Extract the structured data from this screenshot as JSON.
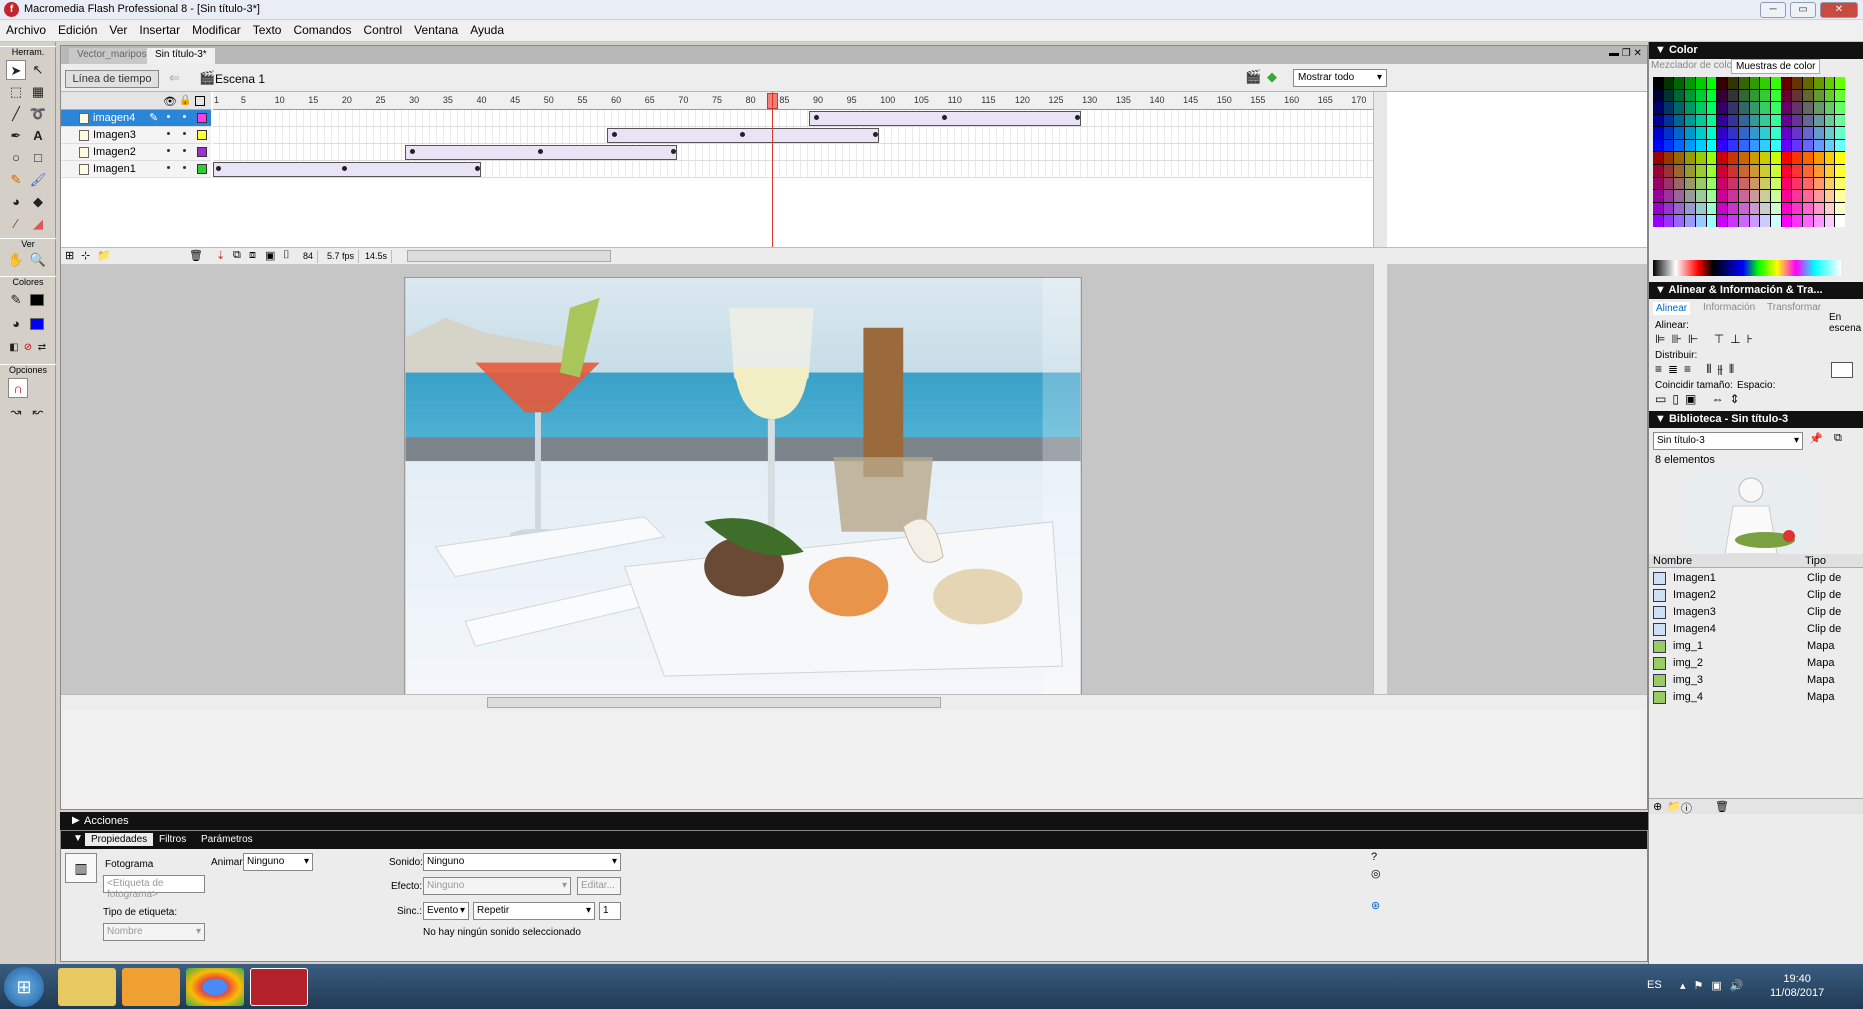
{
  "window": {
    "title": "Macromedia Flash Professional 8 - [Sin título-3*]"
  },
  "menu": [
    "Archivo",
    "Edición",
    "Ver",
    "Insertar",
    "Modificar",
    "Texto",
    "Comandos",
    "Control",
    "Ventana",
    "Ayuda"
  ],
  "tools": {
    "heading": "Herram.",
    "view_heading": "Ver",
    "colors_heading": "Colores",
    "options_heading": "Opciones"
  },
  "doc": {
    "tabs": [
      "Vector_mariposa",
      "Sin título-3*"
    ],
    "timeline_button": "Línea de tiempo",
    "scene": "Escena 1",
    "zoom": "Mostrar todo"
  },
  "timeline": {
    "layers": [
      {
        "name": "imagen4"
      },
      {
        "name": "Imagen3"
      },
      {
        "name": "Imagen2"
      },
      {
        "name": "Imagen1"
      }
    ],
    "ruler": [
      "1",
      "5",
      "10",
      "15",
      "20",
      "25",
      "30",
      "35",
      "40",
      "45",
      "50",
      "55",
      "60",
      "65",
      "70",
      "75",
      "80",
      "85",
      "90",
      "95",
      "100",
      "105",
      "110",
      "115",
      "120",
      "125",
      "130",
      "135",
      "140",
      "145",
      "150",
      "155",
      "160",
      "165",
      "170"
    ],
    "current_frame": "84",
    "fps": "5.7 fps",
    "time": "14.5s"
  },
  "panels": {
    "actions": "Acciones",
    "tabs": [
      "Propiedades",
      "Filtros",
      "Parámetros"
    ]
  },
  "props": {
    "frame_label": "Fotograma",
    "frame_label_placeholder": "<Etiqueta de fotograma>",
    "tween_label": "Animar:",
    "tween_value": "Ninguno",
    "sound_label": "Sonido:",
    "sound_value": "Ninguno",
    "effect_label": "Efecto:",
    "effect_value": "Ninguno",
    "edit_button": "Editar...",
    "label_type_label": "Tipo de etiqueta:",
    "label_type_value": "Nombre",
    "sync_label": "Sinc.:",
    "sync_value": "Evento",
    "repeat_value": "Repetir",
    "repeat_count": "1",
    "status": "No hay ningún sonido seleccionado"
  },
  "color_panel": {
    "title": "Color",
    "tabs": [
      "Mezclador de colo",
      "Muestras de color"
    ]
  },
  "align_panel": {
    "title": "Alinear & Información & Tra...",
    "tabs": [
      "Alinear",
      "Información",
      "Transformar"
    ],
    "align": "Alinear:",
    "distribute": "Distribuir:",
    "match": "Coincidir tamaño:",
    "space": "Espacio:",
    "to_stage": "En escena"
  },
  "library": {
    "title": "Biblioteca - Sin título-3",
    "doc": "Sin título-3",
    "count": "8 elementos",
    "col_name": "Nombre",
    "col_type": "Tipo",
    "items": [
      {
        "name": "Imagen1",
        "type": "Clip de"
      },
      {
        "name": "Imagen2",
        "type": "Clip de"
      },
      {
        "name": "Imagen3",
        "type": "Clip de"
      },
      {
        "name": "Imagen4",
        "type": "Clip de"
      },
      {
        "name": "img_1",
        "type": "Mapa"
      },
      {
        "name": "img_2",
        "type": "Mapa"
      },
      {
        "name": "img_3",
        "type": "Mapa"
      },
      {
        "name": "img_4",
        "type": "Mapa"
      }
    ]
  },
  "taskbar": {
    "lang": "ES",
    "time": "19:40",
    "date": "11/08/2017"
  },
  "colors": {
    "accent": "#2b86d7",
    "playhead": "#e0342c"
  }
}
